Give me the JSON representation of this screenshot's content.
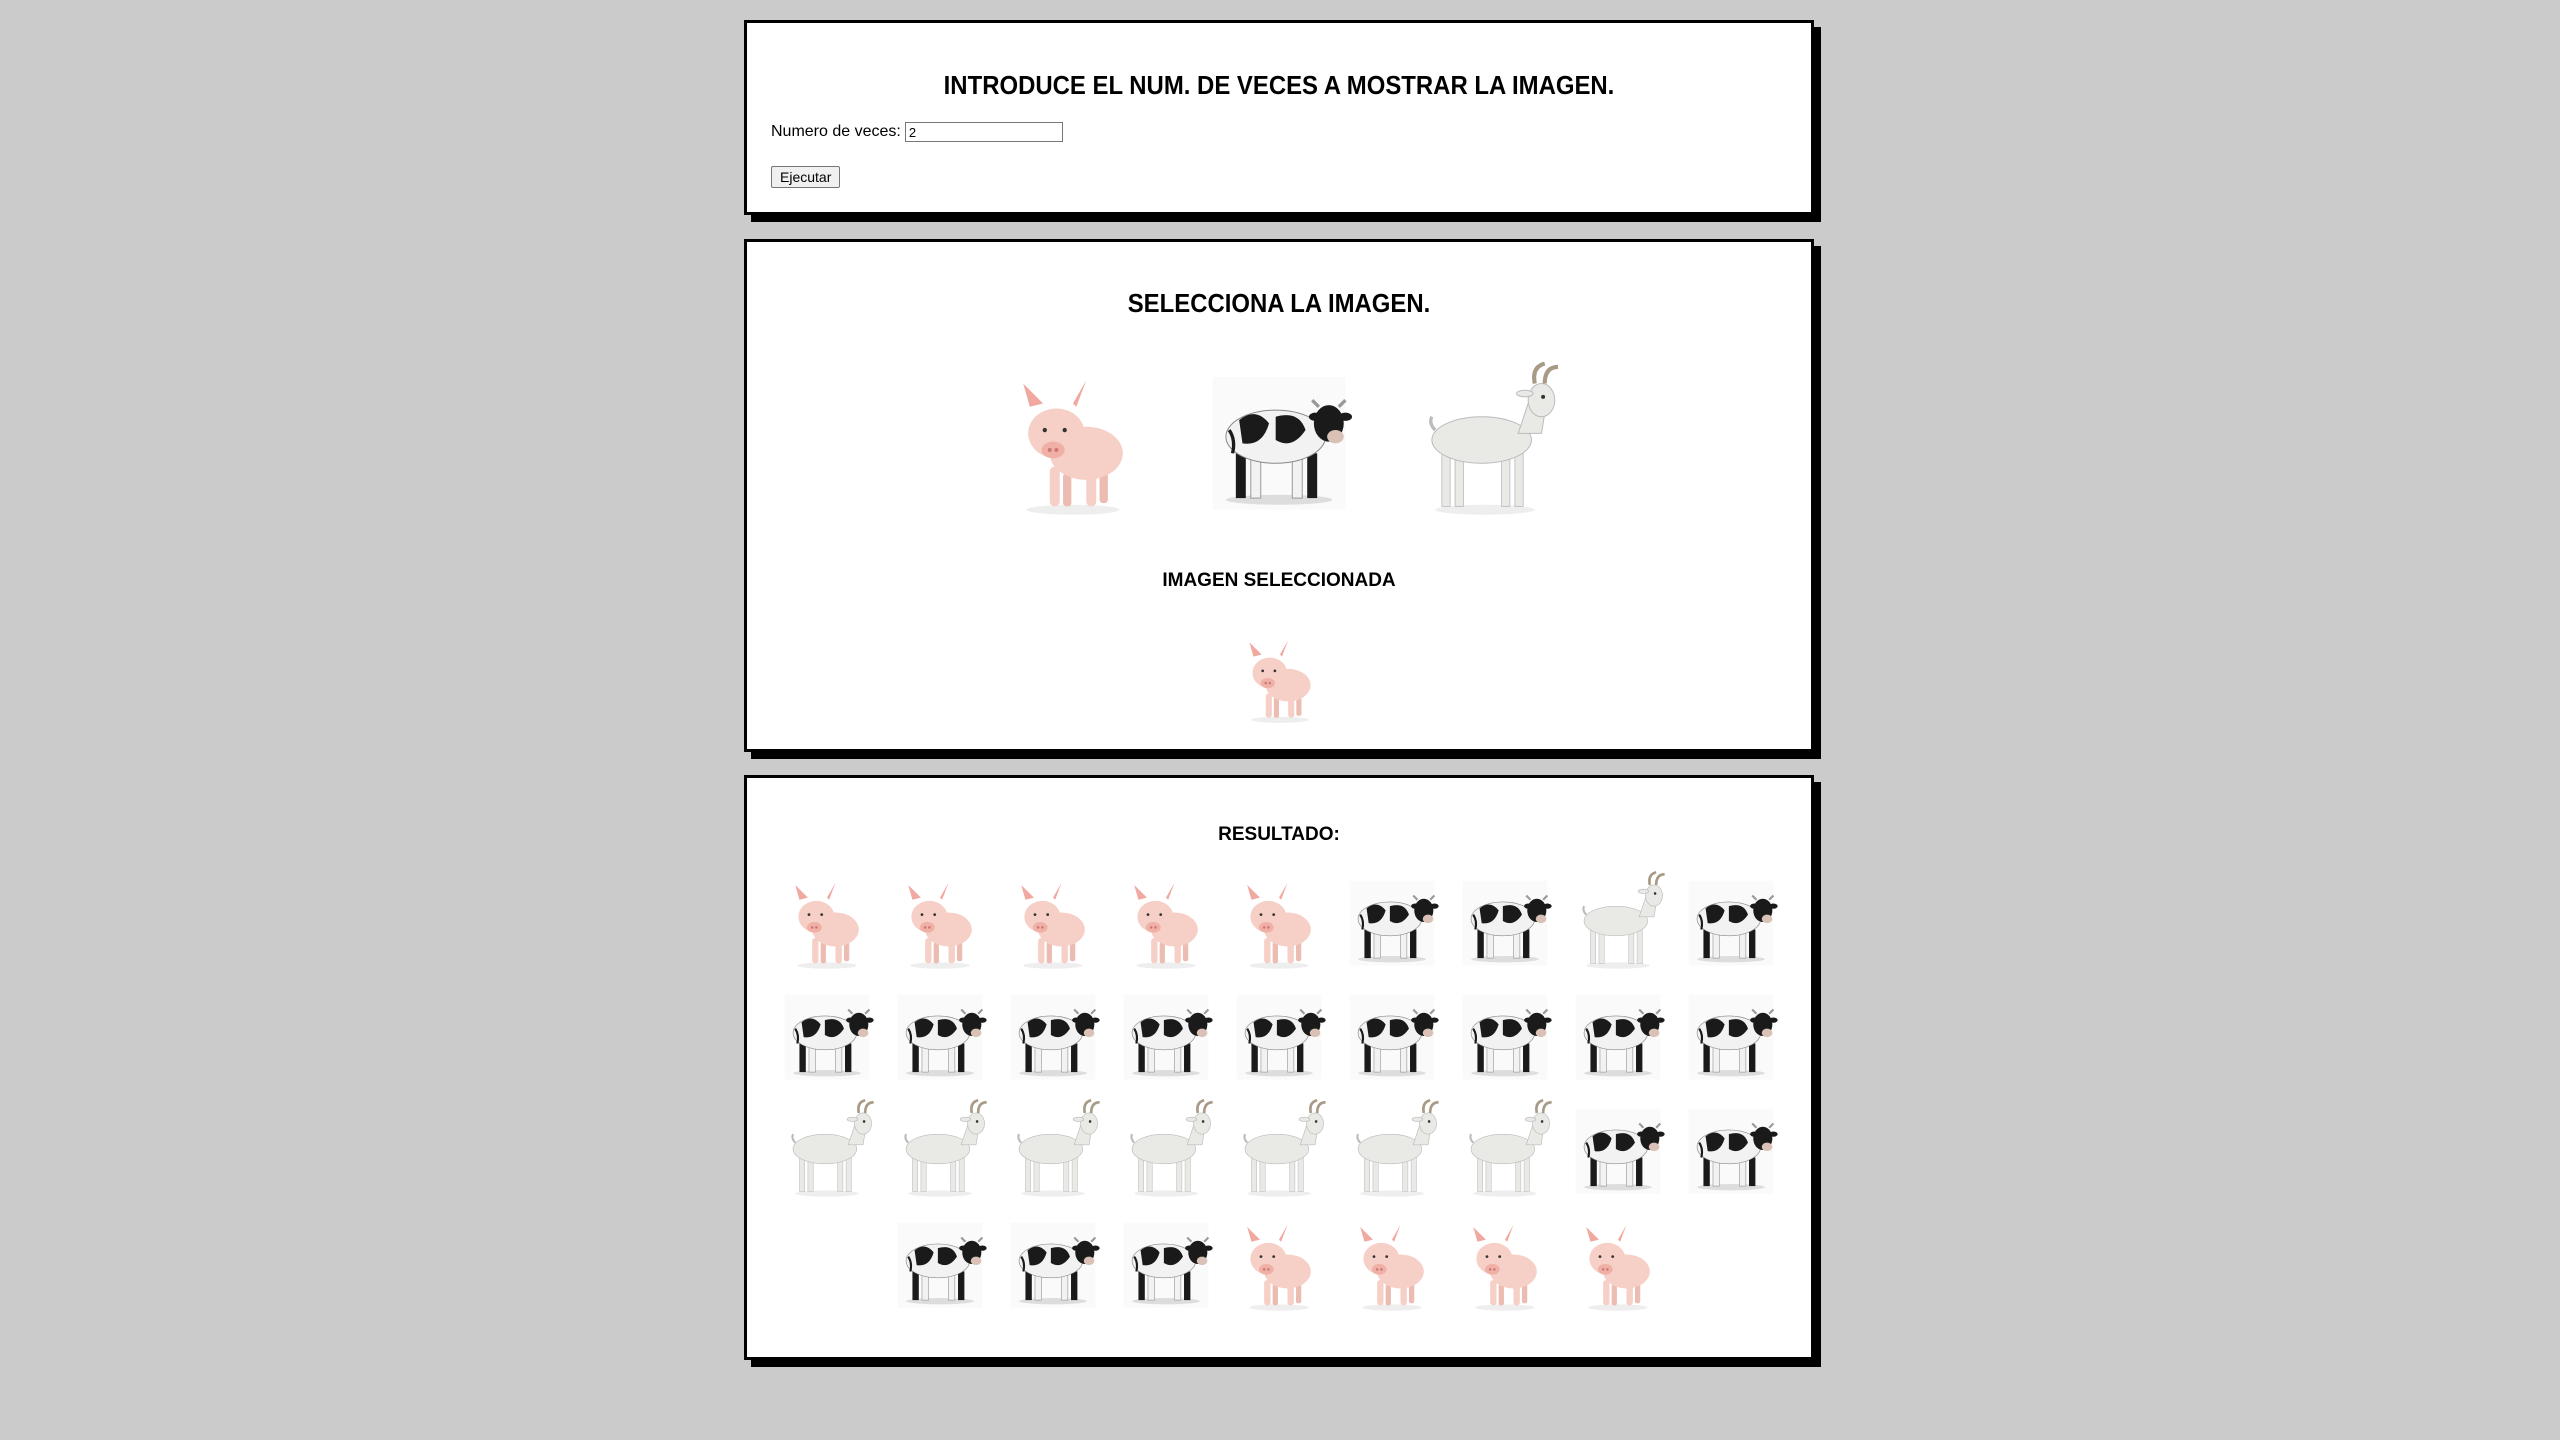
{
  "input_panel": {
    "title": "INTRODUCE EL NUM. DE VECES A MOSTRAR LA IMAGEN.",
    "field_label": "Numero de veces:",
    "field_value": "2",
    "button_label": "Ejecutar"
  },
  "select_panel": {
    "title": "SELECCIONA LA IMAGEN.",
    "options": [
      "pig",
      "cow",
      "goat"
    ],
    "selected_label": "IMAGEN SELECCIONADA",
    "selected": "pig"
  },
  "result_panel": {
    "label": "RESULTADO:",
    "items": [
      "pig",
      "pig",
      "pig",
      "pig",
      "pig",
      "cow",
      "cow",
      "goat",
      "cow",
      "cow",
      "cow",
      "cow",
      "cow",
      "cow",
      "cow",
      "cow",
      "cow",
      "cow",
      "goat",
      "goat",
      "goat",
      "goat",
      "goat",
      "goat",
      "goat",
      "cow",
      "cow",
      "cow",
      "cow",
      "cow",
      "pig",
      "pig",
      "pig",
      "pig"
    ]
  },
  "colors": {
    "background": "#cbcbcb",
    "panel": "#ffffff",
    "border": "#000000",
    "pig": "#f6cfc6",
    "cow_white": "#f2f2f2",
    "cow_black": "#1a1a1a",
    "goat": "#e9e9e6"
  }
}
